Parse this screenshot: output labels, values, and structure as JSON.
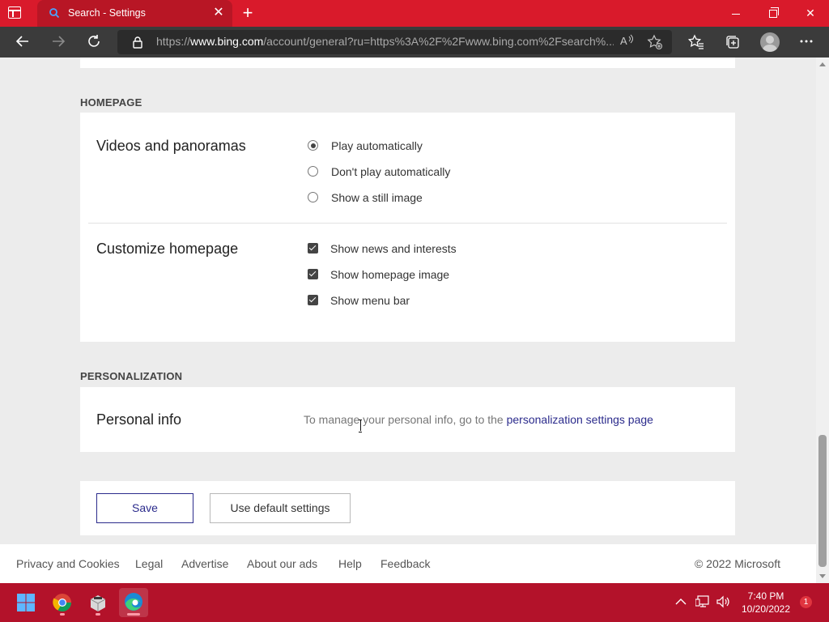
{
  "browser": {
    "tab_title": "Search - Settings",
    "new_tab_symbol": "+",
    "close_symbol": "✕",
    "url_prefix": "https://",
    "url_domain": "www.bing.com",
    "url_rest": "/account/general?ru=https%3A%2F%2Fwww.bing.com%2Fsearch%...",
    "accent_color": "#d91a2b"
  },
  "homepage": {
    "section_label": "HOMEPAGE",
    "videos": {
      "title": "Videos and panoramas",
      "options": [
        {
          "label": "Play automatically",
          "selected": true
        },
        {
          "label": "Don't play automatically",
          "selected": false
        },
        {
          "label": "Show a still image",
          "selected": false
        }
      ]
    },
    "customize": {
      "title": "Customize homepage",
      "options": [
        {
          "label": "Show news and interests",
          "checked": true
        },
        {
          "label": "Show homepage image",
          "checked": true
        },
        {
          "label": "Show menu bar",
          "checked": true
        }
      ]
    }
  },
  "personalization": {
    "section_label": "PERSONALIZATION",
    "title": "Personal info",
    "text": "To manage your personal info, go to the ",
    "link": "personalization settings page"
  },
  "actions": {
    "save_label": "Save",
    "default_label": "Use default settings"
  },
  "footer": {
    "links": [
      "Privacy and Cookies",
      "Legal",
      "Advertise",
      "About our ads",
      "Help",
      "Feedback"
    ],
    "copyright": "© 2022 Microsoft"
  },
  "taskbar": {
    "time": "7:40 PM",
    "date": "10/20/2022",
    "notification_count": "1",
    "color": "#b3122a"
  }
}
